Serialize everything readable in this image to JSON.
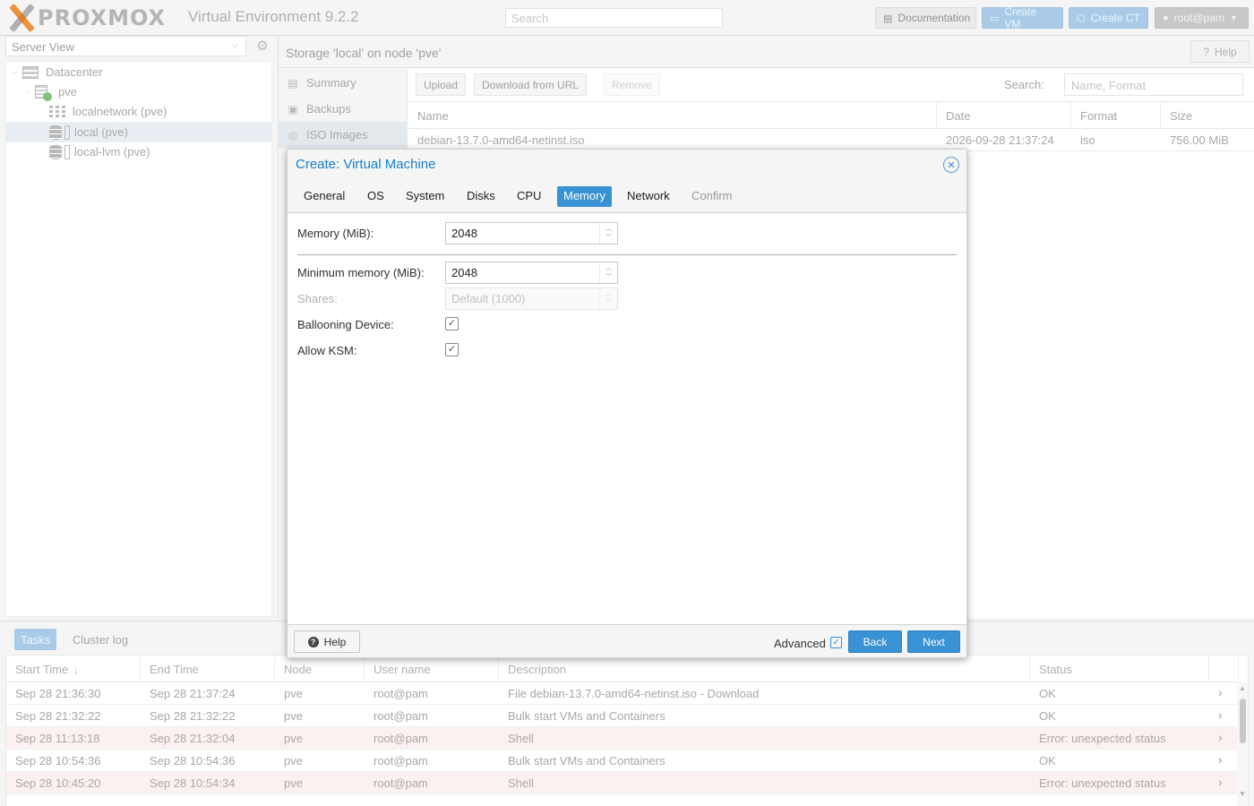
{
  "app": {
    "logo_text": "PROXMOX",
    "product": "Virtual Environment 9.2.2",
    "search_placeholder": "Search",
    "buttons": {
      "documentation": "Documentation",
      "create_vm": "Create VM",
      "create_ct": "Create CT",
      "user": "root@pam"
    }
  },
  "tree": {
    "view_selector": "Server View",
    "nodes": [
      {
        "label": "Datacenter",
        "icon": "datacenter-icon"
      },
      {
        "label": "pve",
        "icon": "node-icon"
      },
      {
        "label": "localnetwork (pve)",
        "icon": "network-icon"
      },
      {
        "label": "local (pve)",
        "icon": "storage-icon",
        "selected": true
      },
      {
        "label": "local-lvm (pve)",
        "icon": "storage-icon"
      }
    ]
  },
  "storage": {
    "title": "Storage 'local' on node 'pve'",
    "help_label": "Help",
    "nav": [
      {
        "label": "Summary",
        "icon": "book-icon"
      },
      {
        "label": "Backups",
        "icon": "floppy-icon"
      },
      {
        "label": "ISO Images",
        "icon": "disc-icon"
      }
    ],
    "toolbar": {
      "upload": "Upload",
      "download_url": "Download from URL",
      "remove": "Remove",
      "search_label": "Search:",
      "search_placeholder": "Name, Format"
    },
    "columns": [
      "Name",
      "Date",
      "Format",
      "Size"
    ],
    "rows": [
      {
        "name": "debian-13.7.0-amd64-netinst.iso",
        "date": "2026-09-28 21:37:24",
        "format": "iso",
        "size": "756.00 MiB"
      }
    ]
  },
  "tasks": {
    "tab_tasks": "Tasks",
    "tab_cluster_log": "Cluster log",
    "columns": [
      "Start Time",
      "End Time",
      "Node",
      "User name",
      "Description",
      "Status"
    ],
    "rows": [
      {
        "start": "Sep 28 21:36:30",
        "end": "Sep 28 21:37:24",
        "node": "pve",
        "user": "root@pam",
        "description": "File debian-13.7.0-amd64-netinst.iso - Download",
        "status": "OK"
      },
      {
        "start": "Sep 28 21:32:22",
        "end": "Sep 28 21:32:22",
        "node": "pve",
        "user": "root@pam",
        "description": "Bulk start VMs and Containers",
        "status": "OK"
      },
      {
        "start": "Sep 28 11:13:18",
        "end": "Sep 28 21:32:04",
        "node": "pve",
        "user": "root@pam",
        "description": "Shell",
        "status": "Error: unexpected status"
      },
      {
        "start": "Sep 28 10:54:36",
        "end": "Sep 28 10:54:36",
        "node": "pve",
        "user": "root@pam",
        "description": "Bulk start VMs and Containers",
        "status": "OK"
      },
      {
        "start": "Sep 28 10:45:20",
        "end": "Sep 28 10:54:34",
        "node": "pve",
        "user": "root@pam",
        "description": "Shell",
        "status": "Error: unexpected status"
      }
    ]
  },
  "dialog": {
    "title": "Create: Virtual Machine",
    "tabs": [
      "General",
      "OS",
      "System",
      "Disks",
      "CPU",
      "Memory",
      "Network",
      "Confirm"
    ],
    "active_tab": "Memory",
    "fields": {
      "memory_label": "Memory (MiB):",
      "memory_value": "2048",
      "min_memory_label": "Minimum memory (MiB):",
      "min_memory_value": "2048",
      "shares_label": "Shares:",
      "shares_placeholder": "Default (1000)",
      "ballooning_label": "Ballooning Device:",
      "ballooning_checked": true,
      "ksm_label": "Allow KSM:",
      "ksm_checked": true
    },
    "footer": {
      "help": "Help",
      "advanced_label": "Advanced",
      "advanced_checked": true,
      "back": "Back",
      "next": "Next"
    }
  },
  "colors": {
    "accent": "#3892d4",
    "title_blue": "#157fcc",
    "error_row": "#fcf1f1"
  }
}
